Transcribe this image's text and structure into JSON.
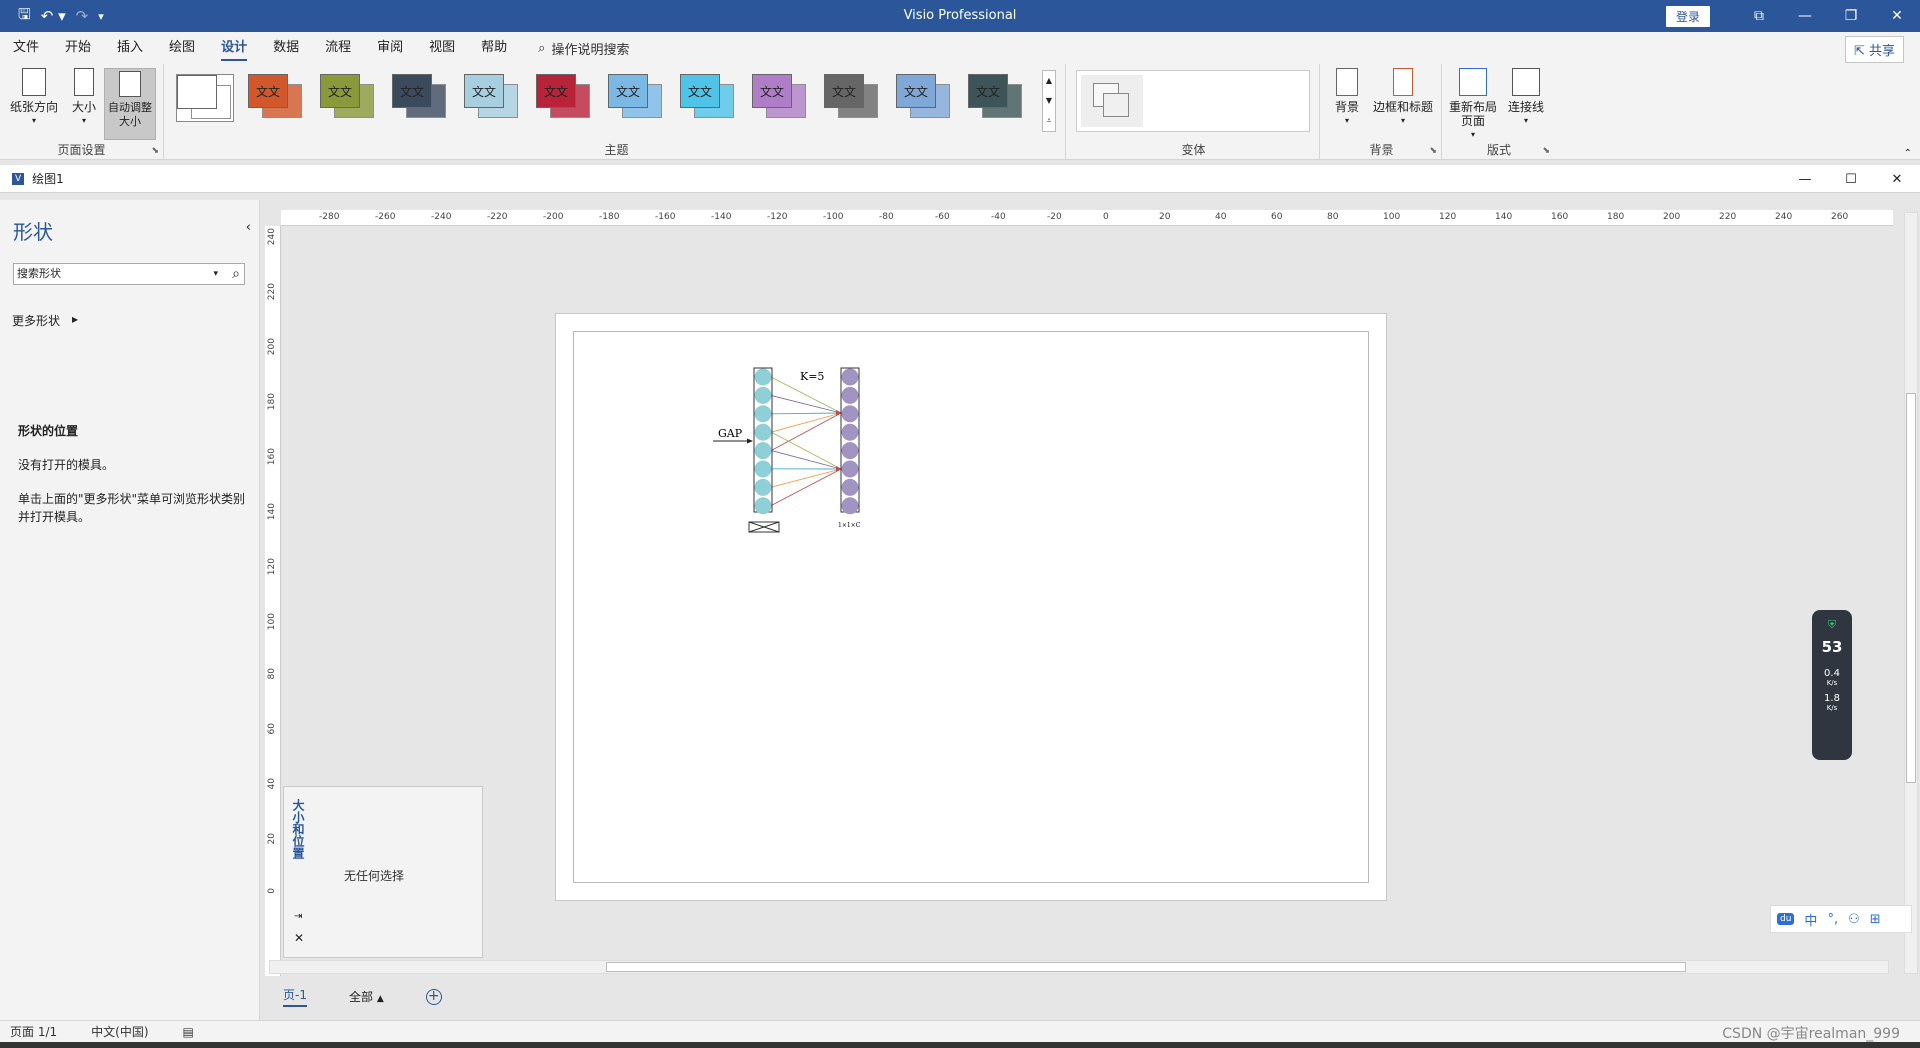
{
  "app": {
    "title": "Visio Professional",
    "login": "登录"
  },
  "menu": {
    "items": [
      "文件",
      "开始",
      "插入",
      "绘图",
      "设计",
      "数据",
      "流程",
      "审阅",
      "视图",
      "帮助"
    ],
    "tell_me": "操作说明搜索",
    "share": "共享"
  },
  "ribbon": {
    "page_setup": {
      "orientation": "纸张方向",
      "size": "大小",
      "auto_size": "自动调整大小",
      "label": "页面设置"
    },
    "themes": {
      "label": "主题",
      "sample_text": "文文",
      "colors": [
        "#ffffff",
        "#d2572a",
        "#8a9a3a",
        "#3c4a5e",
        "#a8cfe0",
        "#b8233a",
        "#7ab8e6",
        "#4fc3e8",
        "#b07ec8",
        "#666666",
        "#7fa8d8",
        "#3d5558"
      ]
    },
    "variants": {
      "label": "变体"
    },
    "backgrounds": {
      "bg": "背景",
      "borders": "边框和标题",
      "label": "背景"
    },
    "layout": {
      "relayout": "重新布局页面",
      "connectors": "连接线",
      "label": "版式"
    }
  },
  "document": {
    "title": "绘图1"
  },
  "shapes": {
    "title": "形状",
    "search_placeholder": "搜索形状",
    "more": "更多形状",
    "stencil_title": "形状的位置",
    "no_stencil": "没有打开的模具。",
    "hint": "单击上面的\"更多形状\"菜单可浏览形状类别并打开模具。"
  },
  "ruler": {
    "h": [
      "-280",
      "-260",
      "-240",
      "-220",
      "-200",
      "-180",
      "-160",
      "-140",
      "-120",
      "-100",
      "-80",
      "-60",
      "-40",
      "-20",
      "0",
      "20",
      "40",
      "60",
      "80",
      "100",
      "120",
      "140",
      "160",
      "180",
      "200",
      "220",
      "240",
      "260"
    ],
    "v": [
      "240",
      "220",
      "200",
      "180",
      "160",
      "140",
      "120",
      "100",
      "80",
      "60",
      "40",
      "20",
      "0"
    ]
  },
  "diagram": {
    "k_label": "K=5",
    "gap_label": "GAP",
    "dim_label": "1×1×C",
    "left_color": "#8ecfd8",
    "right_color": "#a193c2"
  },
  "size_panel": {
    "title": "大小和位置",
    "empty": "无任何选择"
  },
  "pages": {
    "page1": "页-1",
    "all": "全部"
  },
  "status": {
    "page": "页面 1/1",
    "lang": "中文(中国)",
    "watermark": "CSDN @宇宙realman_999"
  },
  "widget": {
    "percent": "53",
    "up": "0.4",
    "down": "1.8",
    "unit": "K/s"
  },
  "ime": {
    "lang": "中"
  }
}
